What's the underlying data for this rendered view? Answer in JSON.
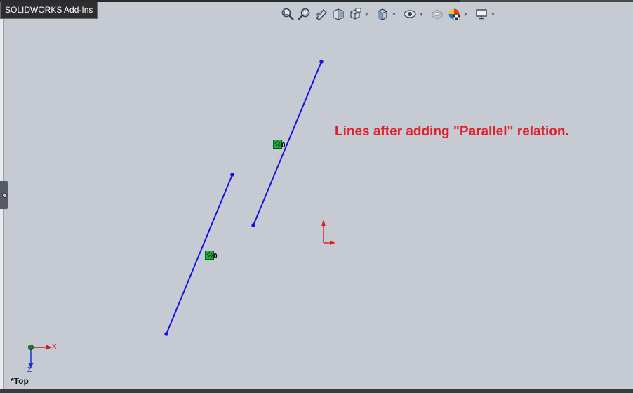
{
  "addins_tab": {
    "label": "SOLIDWORKS Add-Ins"
  },
  "heads_up_toolbar": {
    "items": [
      {
        "icon": "zoom-to-fit-icon"
      },
      {
        "icon": "zoom-to-area-icon"
      },
      {
        "icon": "previous-view-icon"
      },
      {
        "icon": "section-view-icon"
      },
      {
        "icon": "dynamic-annotation-views-icon",
        "dropdown": true
      },
      {
        "icon": "view-orientation-icon",
        "dropdown": true
      },
      {
        "icon": "display-style-icon",
        "dropdown": true
      },
      {
        "icon": "hide-show-items-icon"
      },
      {
        "icon": "edit-appearance-icon",
        "dropdown": true
      },
      {
        "icon": "apply-scene-icon",
        "dropdown": true
      },
      {
        "icon": "view-settings-icon",
        "dropdown": true
      }
    ]
  },
  "annotation": {
    "text": "Lines after adding \"Parallel\" relation.",
    "color": "#e0202a"
  },
  "relations": [
    {
      "type": "parallel",
      "count": "0"
    },
    {
      "type": "parallel",
      "count": "0"
    }
  ],
  "triad": {
    "x_label": "X",
    "z_label": "Z"
  },
  "view": {
    "name": "*Top"
  },
  "colors": {
    "sketch_line": "#1515e0",
    "background": "#c6cad3",
    "origin": "#e02020"
  }
}
